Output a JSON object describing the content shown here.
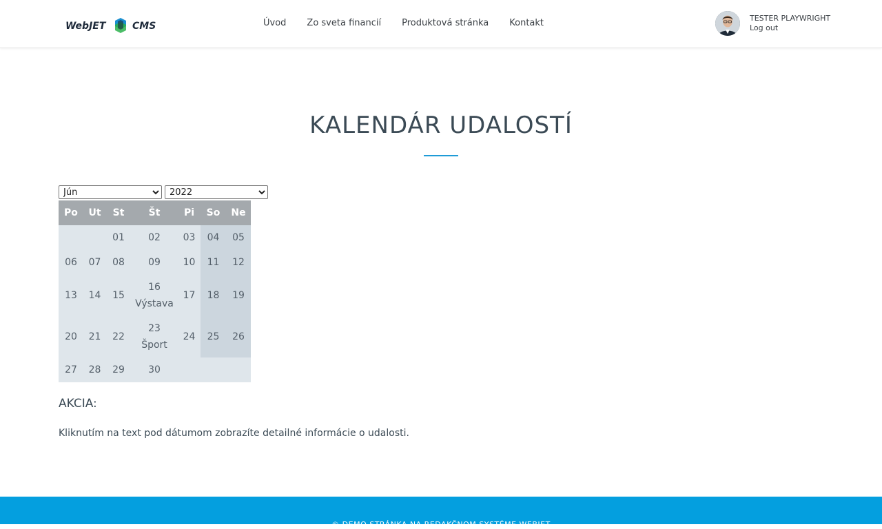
{
  "header": {
    "logo_alt": "WebJET CMS",
    "nav": [
      "Úvod",
      "Zo sveta financií",
      "Produktová stránka",
      "Kontakt"
    ],
    "user": {
      "name": "TESTER PLAYWRIGHT",
      "logout": "Log out"
    }
  },
  "page": {
    "title": "KALENDÁR UDALOSTÍ",
    "month_select": "Jún",
    "year_select": "2022",
    "weekdays": [
      "Po",
      "Ut",
      "St",
      "Št",
      "Pi",
      "So",
      "Ne"
    ],
    "weeks": [
      [
        "",
        "",
        "01",
        "02",
        "03",
        "04",
        "05"
      ],
      [
        "06",
        "07",
        "08",
        "09",
        "10",
        "11",
        "12"
      ],
      [
        "13",
        "14",
        "15",
        "16",
        "17",
        "18",
        "19"
      ],
      [
        "20",
        "21",
        "22",
        "23",
        "24",
        "25",
        "26"
      ],
      [
        "27",
        "28",
        "29",
        "30",
        "",
        "",
        ""
      ]
    ],
    "events": [
      {
        "day": "16",
        "label": "Výstava"
      },
      {
        "day": "23",
        "label": "Šport"
      }
    ],
    "akcia_label": "AKCIA:",
    "hint": "Kliknutím na text pod dátumom zobrazíte detailné informácie o udalosti."
  },
  "footer": {
    "text": "© DEMO STRÁNKA NA REDAKČNOM SYSTÉME WEBJET"
  },
  "colors": {
    "accent": "#049fdf",
    "header_cell": "#a4a9ad",
    "cell": "#dfe6eb",
    "weekend_cell": "#ccd6de"
  }
}
